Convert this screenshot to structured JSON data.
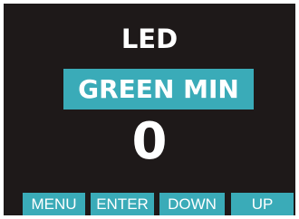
{
  "display": {
    "title": "LED",
    "mode": "GREEN MIN",
    "value": "0"
  },
  "buttons": {
    "menu": "MENU",
    "enter": "ENTER",
    "down": "DOWN",
    "up": "UP"
  },
  "colors": {
    "screen_background": "#1e1919",
    "accent": "#3aabb8",
    "text": "#ffffff"
  }
}
